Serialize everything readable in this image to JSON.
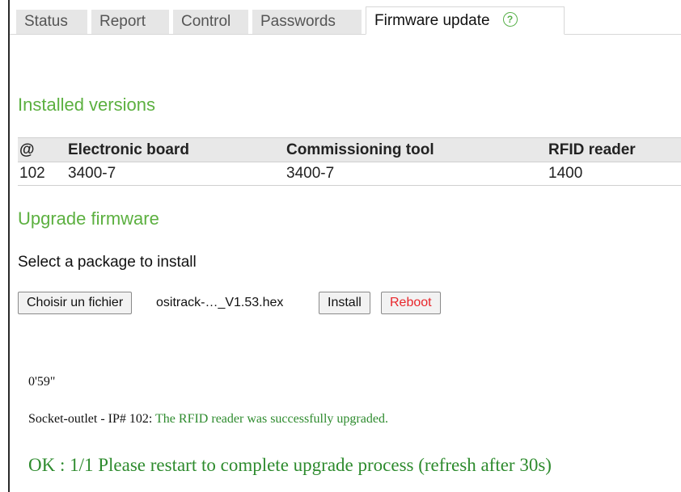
{
  "tabs": [
    {
      "label": "Status"
    },
    {
      "label": "Report"
    },
    {
      "label": "Control"
    },
    {
      "label": "Passwords"
    },
    {
      "label": "Firmware update",
      "active": true
    }
  ],
  "help_icon": {
    "glyph": "?",
    "icon": "help-icon",
    "color": "#58b04a"
  },
  "installed": {
    "title": "Installed versions",
    "columns": [
      "@",
      "Electronic board",
      "Commissioning tool",
      "RFID reader"
    ],
    "rows": [
      [
        "102",
        "3400-7",
        "3400-7",
        "1400"
      ]
    ]
  },
  "upgrade": {
    "title": "Upgrade firmware",
    "prompt": "Select a package to install",
    "choose_file_label": "Choisir un fichier",
    "file_name": "ositrack-…_V1.53.hex",
    "install_label": "Install",
    "reboot_label": "Reboot"
  },
  "log": {
    "elapsed": "0'59\"",
    "device_prefix": "Socket-outlet - IP# 102: ",
    "device_message": "The RFID reader was successfully upgraded.",
    "result": "OK : 1/1 Please restart to complete upgrade process (refresh after 30s)"
  },
  "colors": {
    "accent_green": "#5cb040",
    "message_green": "#2e8b2e",
    "reboot_red": "#e8262b"
  }
}
